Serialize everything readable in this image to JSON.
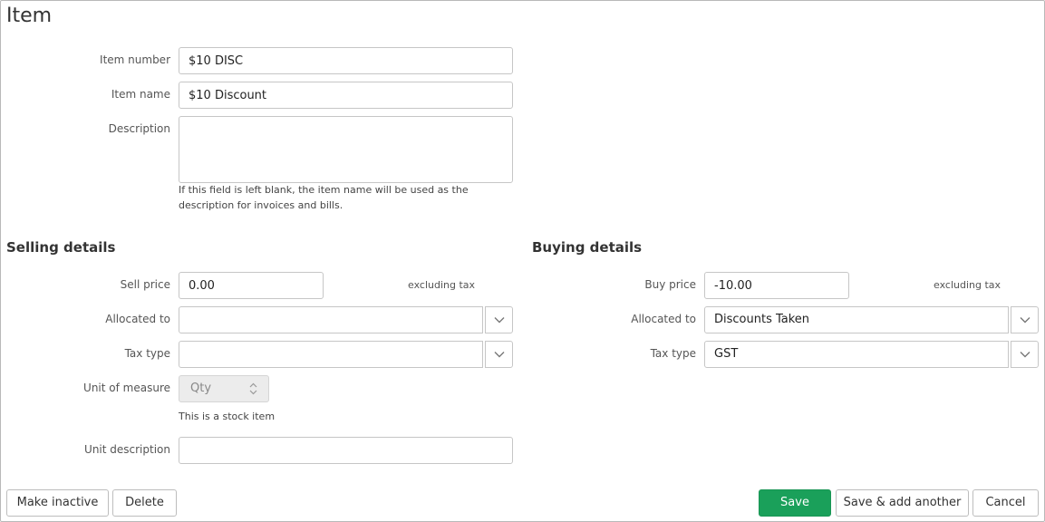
{
  "page": {
    "title": "Item"
  },
  "item": {
    "number_label": "Item number",
    "number_value": "$10 DISC",
    "name_label": "Item name",
    "name_value": "$10 Discount",
    "description_label": "Description",
    "description_value": "",
    "description_hint": "If this field is left blank, the item name will be used as the description for invoices and bills."
  },
  "selling": {
    "title": "Selling details",
    "price_label": "Sell price",
    "price_value": "0.00",
    "price_suffix": "excluding tax",
    "allocated_label": "Allocated to",
    "allocated_value": "",
    "tax_label": "Tax type",
    "tax_value": "",
    "uom_label": "Unit of measure",
    "uom_value": "Qty",
    "stock_note": "This is a stock item",
    "unit_desc_label": "Unit description",
    "unit_desc_value": ""
  },
  "buying": {
    "title": "Buying details",
    "price_label": "Buy price",
    "price_value": "-10.00",
    "price_suffix": "excluding tax",
    "allocated_label": "Allocated to",
    "allocated_value": "Discounts Taken",
    "tax_label": "Tax type",
    "tax_value": "GST"
  },
  "actions": {
    "make_inactive": "Make inactive",
    "delete": "Delete",
    "save": "Save",
    "save_add_another": "Save & add another",
    "cancel": "Cancel"
  },
  "colors": {
    "primary": "#1aa05a",
    "border": "#c6c6c6"
  },
  "icons": {
    "dropdown": "chevron-down-icon",
    "stepper": "updown-icon"
  }
}
